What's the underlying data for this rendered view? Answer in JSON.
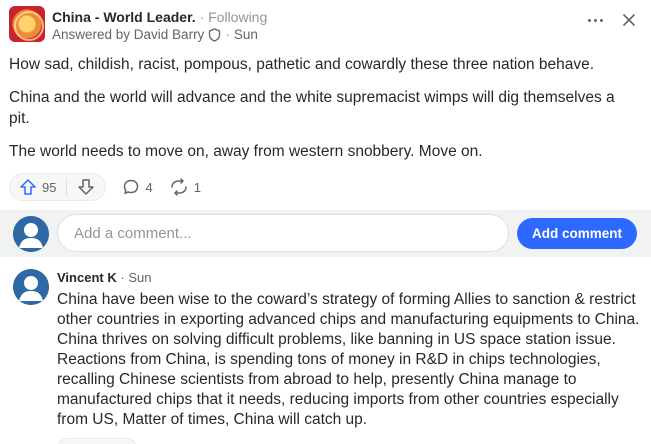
{
  "post": {
    "space_name": "China - World Leader.",
    "separator": "·",
    "follow_status": "Following",
    "answered_by_label": "Answered by David Barry",
    "answer_time": "Sun",
    "paragraphs": [
      "How sad, childish, racist, pompous, pathetic and cowardly these three nation behave.",
      "China and the world will advance and the white supremacist wimps will dig themselves a pit.",
      "The world needs to move on, away from western snobbery. Move on."
    ]
  },
  "actions": {
    "upvote_count": "95",
    "comment_count": "4",
    "share_count": "1"
  },
  "comment_box": {
    "placeholder": "Add a comment...",
    "button_label": "Add comment"
  },
  "comments": [
    {
      "author": "Vincent K",
      "time": "Sun",
      "text": "China have been wise to the coward’s strategy of forming Allies to sanction & restrict other countries in exporting advanced chips and manufacturing equipments to China. China thrives on solving difficult problems, like banning in US space station issue. Reactions from China, is spending tons of money in R&D in chips technologies, recalling Chinese scientists from abroad to help, presently China manage to manufactured chips that it needs, reducing imports from other countries especially from US, Matter of times, China will catch up."
    }
  ],
  "colors": {
    "accent": "#2e69ff",
    "text": "#282829",
    "muted": "#636466",
    "avatar": "#2e69a6"
  },
  "icons": [
    "space-logo-icon",
    "shield-icon",
    "more-options-icon",
    "close-icon",
    "upvote-arrow-icon",
    "downvote-arrow-icon",
    "comment-bubble-icon",
    "share-icon",
    "user-avatar-icon"
  ]
}
